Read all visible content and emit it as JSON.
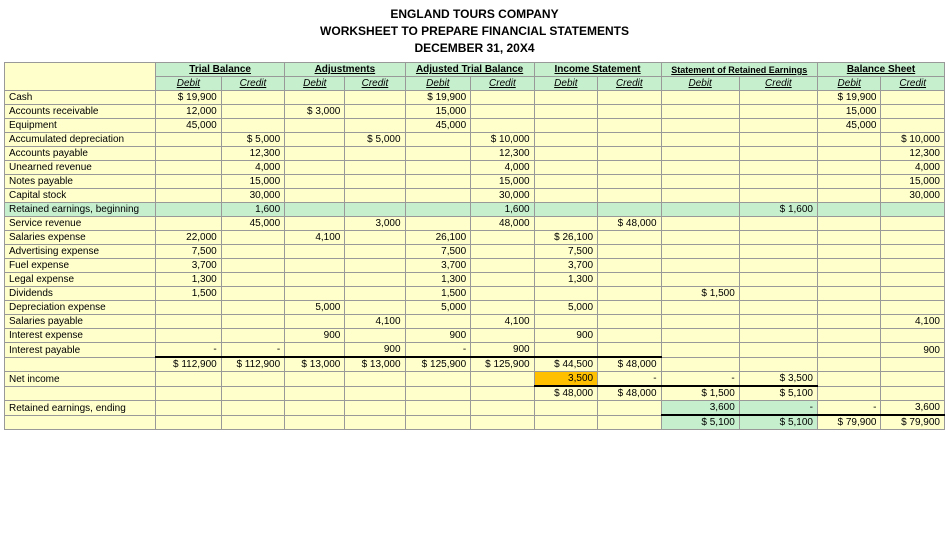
{
  "title": {
    "line1": "ENGLAND TOURS COMPANY",
    "line2": "WORKSHEET TO PREPARE FINANCIAL STATEMENTS",
    "line3": "DECEMBER 31, 20X4"
  },
  "headers": {
    "trial_balance": "Trial Balance",
    "adjustments": "Adjustments",
    "adjusted_trial_balance": "Adjusted Trial Balance",
    "income_statement": "Income Statement",
    "statement_retained": "Statement of Retained Earnings",
    "balance_sheet": "Balance Sheet"
  },
  "subheaders": {
    "debit": "Debit",
    "credit": "Credit"
  },
  "rows": [
    {
      "label": "Cash",
      "tb_d": "$ 19,900",
      "tb_c": "",
      "adj_d": "",
      "adj_c": "",
      "atb_d": "$ 19,900",
      "atb_c": "",
      "is_d": "",
      "is_c": "",
      "sre_d": "",
      "sre_c": "",
      "bs_d": "$ 19,900",
      "bs_c": "",
      "highlight": false
    },
    {
      "label": "Accounts receivable",
      "tb_d": "12,000",
      "tb_c": "",
      "adj_d": "$ 3,000",
      "adj_c": "",
      "atb_d": "15,000",
      "atb_c": "",
      "is_d": "",
      "is_c": "",
      "sre_d": "",
      "sre_c": "",
      "bs_d": "15,000",
      "bs_c": "",
      "highlight": false
    },
    {
      "label": "Equipment",
      "tb_d": "45,000",
      "tb_c": "",
      "adj_d": "",
      "adj_c": "",
      "atb_d": "45,000",
      "atb_c": "",
      "is_d": "",
      "is_c": "",
      "sre_d": "",
      "sre_c": "",
      "bs_d": "45,000",
      "bs_c": "",
      "highlight": false
    },
    {
      "label": "Accumulated depreciation",
      "tb_d": "",
      "tb_c": "$ 5,000",
      "adj_d": "",
      "adj_c": "$ 5,000",
      "atb_d": "",
      "atb_c": "$ 10,000",
      "is_d": "",
      "is_c": "",
      "sre_d": "",
      "sre_c": "",
      "bs_d": "",
      "bs_c": "$ 10,000",
      "highlight": false
    },
    {
      "label": "Accounts payable",
      "tb_d": "",
      "tb_c": "12,300",
      "adj_d": "",
      "adj_c": "",
      "atb_d": "",
      "atb_c": "12,300",
      "is_d": "",
      "is_c": "",
      "sre_d": "",
      "sre_c": "",
      "bs_d": "",
      "bs_c": "12,300",
      "highlight": false
    },
    {
      "label": "Unearned revenue",
      "tb_d": "",
      "tb_c": "4,000",
      "adj_d": "",
      "adj_c": "",
      "atb_d": "",
      "atb_c": "4,000",
      "is_d": "",
      "is_c": "",
      "sre_d": "",
      "sre_c": "",
      "bs_d": "",
      "bs_c": "4,000",
      "highlight": false
    },
    {
      "label": "Notes payable",
      "tb_d": "",
      "tb_c": "15,000",
      "adj_d": "",
      "adj_c": "",
      "atb_d": "",
      "atb_c": "15,000",
      "is_d": "",
      "is_c": "",
      "sre_d": "",
      "sre_c": "",
      "bs_d": "",
      "bs_c": "15,000",
      "highlight": false
    },
    {
      "label": "Capital stock",
      "tb_d": "",
      "tb_c": "30,000",
      "adj_d": "",
      "adj_c": "",
      "atb_d": "",
      "atb_c": "30,000",
      "is_d": "",
      "is_c": "",
      "sre_d": "",
      "sre_c": "",
      "bs_d": "",
      "bs_c": "30,000",
      "highlight": false
    },
    {
      "label": "Retained earnings, beginning",
      "tb_d": "",
      "tb_c": "1,600",
      "adj_d": "",
      "adj_c": "",
      "atb_d": "",
      "atb_c": "1,600",
      "is_d": "",
      "is_c": "",
      "sre_d": "",
      "sre_c": "$ 1,600",
      "bs_d": "",
      "bs_c": "",
      "highlight": true
    },
    {
      "label": "Service revenue",
      "tb_d": "",
      "tb_c": "45,000",
      "adj_d": "",
      "adj_c": "3,000",
      "atb_d": "",
      "atb_c": "48,000",
      "is_d": "",
      "is_c": "$ 48,000",
      "sre_d": "",
      "sre_c": "",
      "bs_d": "",
      "bs_c": "",
      "highlight": false
    },
    {
      "label": "Salaries expense",
      "tb_d": "22,000",
      "tb_c": "",
      "adj_d": "4,100",
      "adj_c": "",
      "atb_d": "26,100",
      "atb_c": "",
      "is_d": "$ 26,100",
      "is_c": "",
      "sre_d": "",
      "sre_c": "",
      "bs_d": "",
      "bs_c": "",
      "highlight": false
    },
    {
      "label": "Advertising expense",
      "tb_d": "7,500",
      "tb_c": "",
      "adj_d": "",
      "adj_c": "",
      "atb_d": "7,500",
      "atb_c": "",
      "is_d": "7,500",
      "is_c": "",
      "sre_d": "",
      "sre_c": "",
      "bs_d": "",
      "bs_c": "",
      "highlight": false
    },
    {
      "label": "Fuel expense",
      "tb_d": "3,700",
      "tb_c": "",
      "adj_d": "",
      "adj_c": "",
      "atb_d": "3,700",
      "atb_c": "",
      "is_d": "3,700",
      "is_c": "",
      "sre_d": "",
      "sre_c": "",
      "bs_d": "",
      "bs_c": "",
      "highlight": false
    },
    {
      "label": "Legal expense",
      "tb_d": "1,300",
      "tb_c": "",
      "adj_d": "",
      "adj_c": "",
      "atb_d": "1,300",
      "atb_c": "",
      "is_d": "1,300",
      "is_c": "",
      "sre_d": "",
      "sre_c": "",
      "bs_d": "",
      "bs_c": "",
      "highlight": false
    },
    {
      "label": "Dividends",
      "tb_d": "1,500",
      "tb_c": "",
      "adj_d": "",
      "adj_c": "",
      "atb_d": "1,500",
      "atb_c": "",
      "is_d": "",
      "is_c": "",
      "sre_d": "$ 1,500",
      "sre_c": "",
      "bs_d": "",
      "bs_c": "",
      "highlight": false
    },
    {
      "label": "Depreciation expense",
      "tb_d": "",
      "tb_c": "",
      "adj_d": "5,000",
      "adj_c": "",
      "atb_d": "5,000",
      "atb_c": "",
      "is_d": "5,000",
      "is_c": "",
      "sre_d": "",
      "sre_c": "",
      "bs_d": "",
      "bs_c": "",
      "highlight": false
    },
    {
      "label": "Salaries payable",
      "tb_d": "",
      "tb_c": "",
      "adj_d": "",
      "adj_c": "4,100",
      "atb_d": "",
      "atb_c": "4,100",
      "is_d": "",
      "is_c": "",
      "sre_d": "",
      "sre_c": "",
      "bs_d": "",
      "bs_c": "4,100",
      "highlight": false
    },
    {
      "label": "Interest expense",
      "tb_d": "",
      "tb_c": "",
      "adj_d": "900",
      "adj_c": "",
      "atb_d": "900",
      "atb_c": "",
      "is_d": "900",
      "is_c": "",
      "sre_d": "",
      "sre_c": "",
      "bs_d": "",
      "bs_c": "",
      "highlight": false
    },
    {
      "label": "Interest payable",
      "tb_d": "-",
      "tb_c": "-",
      "adj_d": "",
      "adj_c": "900",
      "atb_d": "-",
      "atb_c": "900",
      "is_d": "",
      "is_c": "",
      "sre_d": "",
      "sre_c": "",
      "bs_d": "",
      "bs_c": "900",
      "highlight": false
    }
  ],
  "totals_row": {
    "label": "",
    "tb_d": "$ 112,900",
    "tb_c": "$ 112,900",
    "adj_d": "$ 13,000",
    "adj_c": "$ 13,000",
    "atb_d": "$ 125,900",
    "atb_c": "$ 125,900",
    "is_d": "$ 44,500",
    "is_c": "$ 48,000",
    "sre_d": "",
    "sre_c": "",
    "bs_d": "",
    "bs_c": ""
  },
  "net_income_row": {
    "label": "Net income",
    "net_income_val": "3,500",
    "sre_d": "-",
    "sre_c": "$ 3,500",
    "bs_d": "",
    "bs_c": ""
  },
  "totals2_row": {
    "is_d": "$ 48,000",
    "is_c": "$ 48,000",
    "sre_d": "$ 1,500",
    "sre_c": "$ 5,100",
    "bs_d": "",
    "bs_c": ""
  },
  "retained_earnings_row": {
    "label": "Retained earnings, ending",
    "sre_d": "3,600",
    "sre_c": "-",
    "bs_d": "-",
    "bs_c": "3,600"
  },
  "final_totals_row": {
    "sre_d": "$ 5,100",
    "sre_c": "$ 5,100",
    "bs_d": "$ 79,900",
    "bs_c": "$ 79,900"
  }
}
